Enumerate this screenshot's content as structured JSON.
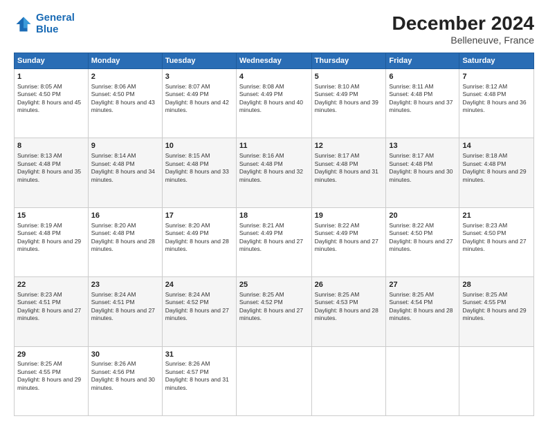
{
  "logo": {
    "line1": "General",
    "line2": "Blue"
  },
  "title": "December 2024",
  "subtitle": "Belleneuve, France",
  "days": [
    "Sunday",
    "Monday",
    "Tuesday",
    "Wednesday",
    "Thursday",
    "Friday",
    "Saturday"
  ],
  "weeks": [
    [
      {
        "day": "1",
        "sunrise": "8:05 AM",
        "sunset": "4:50 PM",
        "daylight": "8 hours and 45 minutes."
      },
      {
        "day": "2",
        "sunrise": "8:06 AM",
        "sunset": "4:50 PM",
        "daylight": "8 hours and 43 minutes."
      },
      {
        "day": "3",
        "sunrise": "8:07 AM",
        "sunset": "4:49 PM",
        "daylight": "8 hours and 42 minutes."
      },
      {
        "day": "4",
        "sunrise": "8:08 AM",
        "sunset": "4:49 PM",
        "daylight": "8 hours and 40 minutes."
      },
      {
        "day": "5",
        "sunrise": "8:10 AM",
        "sunset": "4:49 PM",
        "daylight": "8 hours and 39 minutes."
      },
      {
        "day": "6",
        "sunrise": "8:11 AM",
        "sunset": "4:48 PM",
        "daylight": "8 hours and 37 minutes."
      },
      {
        "day": "7",
        "sunrise": "8:12 AM",
        "sunset": "4:48 PM",
        "daylight": "8 hours and 36 minutes."
      }
    ],
    [
      {
        "day": "8",
        "sunrise": "8:13 AM",
        "sunset": "4:48 PM",
        "daylight": "8 hours and 35 minutes."
      },
      {
        "day": "9",
        "sunrise": "8:14 AM",
        "sunset": "4:48 PM",
        "daylight": "8 hours and 34 minutes."
      },
      {
        "day": "10",
        "sunrise": "8:15 AM",
        "sunset": "4:48 PM",
        "daylight": "8 hours and 33 minutes."
      },
      {
        "day": "11",
        "sunrise": "8:16 AM",
        "sunset": "4:48 PM",
        "daylight": "8 hours and 32 minutes."
      },
      {
        "day": "12",
        "sunrise": "8:17 AM",
        "sunset": "4:48 PM",
        "daylight": "8 hours and 31 minutes."
      },
      {
        "day": "13",
        "sunrise": "8:17 AM",
        "sunset": "4:48 PM",
        "daylight": "8 hours and 30 minutes."
      },
      {
        "day": "14",
        "sunrise": "8:18 AM",
        "sunset": "4:48 PM",
        "daylight": "8 hours and 29 minutes."
      }
    ],
    [
      {
        "day": "15",
        "sunrise": "8:19 AM",
        "sunset": "4:48 PM",
        "daylight": "8 hours and 29 minutes."
      },
      {
        "day": "16",
        "sunrise": "8:20 AM",
        "sunset": "4:48 PM",
        "daylight": "8 hours and 28 minutes."
      },
      {
        "day": "17",
        "sunrise": "8:20 AM",
        "sunset": "4:49 PM",
        "daylight": "8 hours and 28 minutes."
      },
      {
        "day": "18",
        "sunrise": "8:21 AM",
        "sunset": "4:49 PM",
        "daylight": "8 hours and 27 minutes."
      },
      {
        "day": "19",
        "sunrise": "8:22 AM",
        "sunset": "4:49 PM",
        "daylight": "8 hours and 27 minutes."
      },
      {
        "day": "20",
        "sunrise": "8:22 AM",
        "sunset": "4:50 PM",
        "daylight": "8 hours and 27 minutes."
      },
      {
        "day": "21",
        "sunrise": "8:23 AM",
        "sunset": "4:50 PM",
        "daylight": "8 hours and 27 minutes."
      }
    ],
    [
      {
        "day": "22",
        "sunrise": "8:23 AM",
        "sunset": "4:51 PM",
        "daylight": "8 hours and 27 minutes."
      },
      {
        "day": "23",
        "sunrise": "8:24 AM",
        "sunset": "4:51 PM",
        "daylight": "8 hours and 27 minutes."
      },
      {
        "day": "24",
        "sunrise": "8:24 AM",
        "sunset": "4:52 PM",
        "daylight": "8 hours and 27 minutes."
      },
      {
        "day": "25",
        "sunrise": "8:25 AM",
        "sunset": "4:52 PM",
        "daylight": "8 hours and 27 minutes."
      },
      {
        "day": "26",
        "sunrise": "8:25 AM",
        "sunset": "4:53 PM",
        "daylight": "8 hours and 28 minutes."
      },
      {
        "day": "27",
        "sunrise": "8:25 AM",
        "sunset": "4:54 PM",
        "daylight": "8 hours and 28 minutes."
      },
      {
        "day": "28",
        "sunrise": "8:25 AM",
        "sunset": "4:55 PM",
        "daylight": "8 hours and 29 minutes."
      }
    ],
    [
      {
        "day": "29",
        "sunrise": "8:25 AM",
        "sunset": "4:55 PM",
        "daylight": "8 hours and 29 minutes."
      },
      {
        "day": "30",
        "sunrise": "8:26 AM",
        "sunset": "4:56 PM",
        "daylight": "8 hours and 30 minutes."
      },
      {
        "day": "31",
        "sunrise": "8:26 AM",
        "sunset": "4:57 PM",
        "daylight": "8 hours and 31 minutes."
      },
      null,
      null,
      null,
      null
    ]
  ]
}
